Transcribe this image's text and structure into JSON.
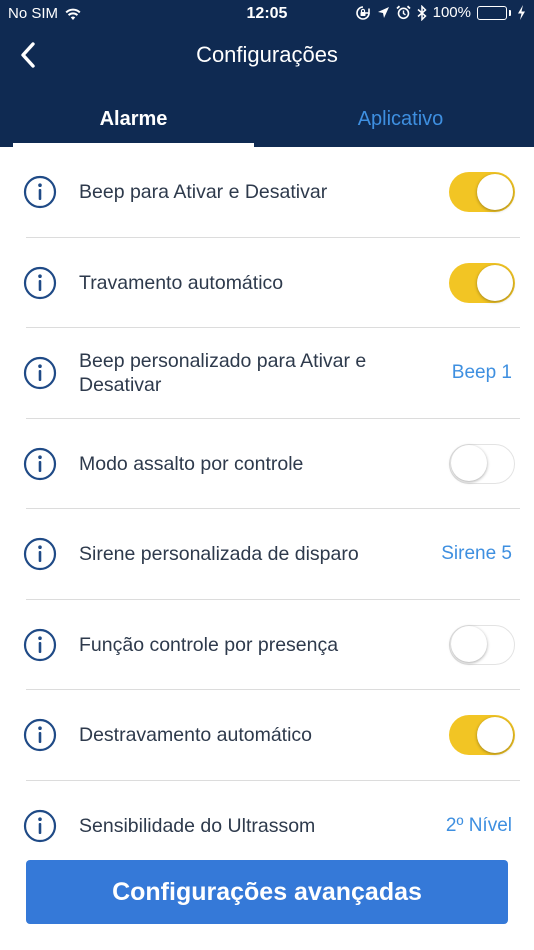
{
  "status_bar": {
    "carrier": "No SIM",
    "time": "12:05",
    "battery": "100%",
    "icons": [
      "wifi-icon",
      "orientation-lock-icon",
      "location-arrow-icon",
      "alarm-icon",
      "bluetooth-icon",
      "battery-icon",
      "charging-bolt-icon"
    ]
  },
  "nav": {
    "title": "Configurações",
    "back_icon": "chevron-left-icon"
  },
  "tabs": [
    {
      "label": "Alarme",
      "active": true
    },
    {
      "label": "Aplicativo",
      "active": false
    }
  ],
  "colors": {
    "header_bg": "#0f2a52",
    "accent_blue": "#3e8fe0",
    "toggle_on": "#f2c524",
    "button_bg": "#3579d8",
    "text_dark": "#2e3a4c"
  },
  "settings": [
    {
      "label": "Beep para Ativar e Desativar",
      "control": "toggle",
      "on": true
    },
    {
      "label": "Travamento automático",
      "control": "toggle",
      "on": true
    },
    {
      "label": "Beep personalizado para Ativar e Desativar",
      "control": "value",
      "value": "Beep 1"
    },
    {
      "label": "Modo assalto por controle",
      "control": "toggle",
      "on": false
    },
    {
      "label": "Sirene personalizada de disparo",
      "control": "value",
      "value": "Sirene 5"
    },
    {
      "label": "Função controle por presença",
      "control": "toggle",
      "on": false
    },
    {
      "label": "Destravamento automático",
      "control": "toggle",
      "on": true
    },
    {
      "label": "Sensibilidade do Ultrassom",
      "control": "value",
      "value": "2º Nível"
    }
  ],
  "footer": {
    "advanced_button_label": "Configurações avançadas"
  }
}
